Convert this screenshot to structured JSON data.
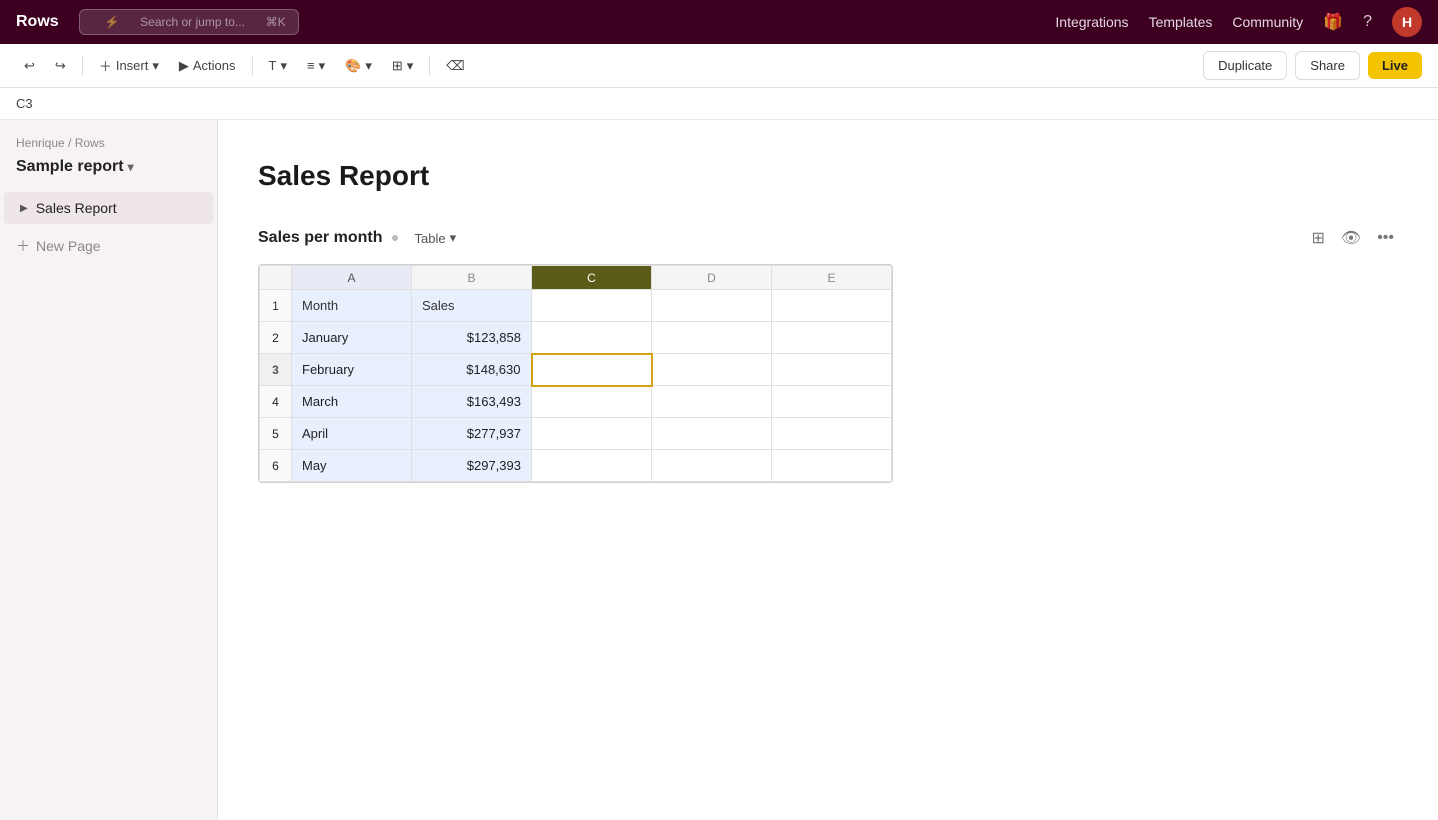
{
  "app": {
    "logo": "Rows"
  },
  "topnav": {
    "search_placeholder": "Search or jump to...",
    "search_shortcut": "⌘K",
    "links": [
      "Integrations",
      "Templates",
      "Community"
    ],
    "avatar_letter": "H"
  },
  "toolbar": {
    "insert_label": "Insert",
    "actions_label": "Actions",
    "duplicate_label": "Duplicate",
    "share_label": "Share",
    "live_label": "Live"
  },
  "cellref": {
    "value": "C3"
  },
  "sidebar": {
    "breadcrumb": "Henrique / Rows",
    "report_title": "Sample report",
    "pages": [
      {
        "label": "Sales Report"
      }
    ],
    "new_page_label": "New Page"
  },
  "content": {
    "page_title": "Sales Report",
    "table_widget": {
      "title": "Sales per month",
      "view_type": "Table",
      "columns": [
        "A",
        "B",
        "C",
        "D",
        "E"
      ],
      "headers": [
        "Month",
        "Sales",
        "",
        "",
        ""
      ],
      "rows": [
        {
          "num": "1",
          "month": "Month",
          "sales": "Sales"
        },
        {
          "num": "2",
          "month": "January",
          "sales": "$123,858"
        },
        {
          "num": "3",
          "month": "February",
          "sales": "$148,630"
        },
        {
          "num": "4",
          "month": "March",
          "sales": "$163,493"
        },
        {
          "num": "5",
          "month": "April",
          "sales": "$277,937"
        },
        {
          "num": "6",
          "month": "May",
          "sales": "$297,393"
        }
      ]
    }
  }
}
